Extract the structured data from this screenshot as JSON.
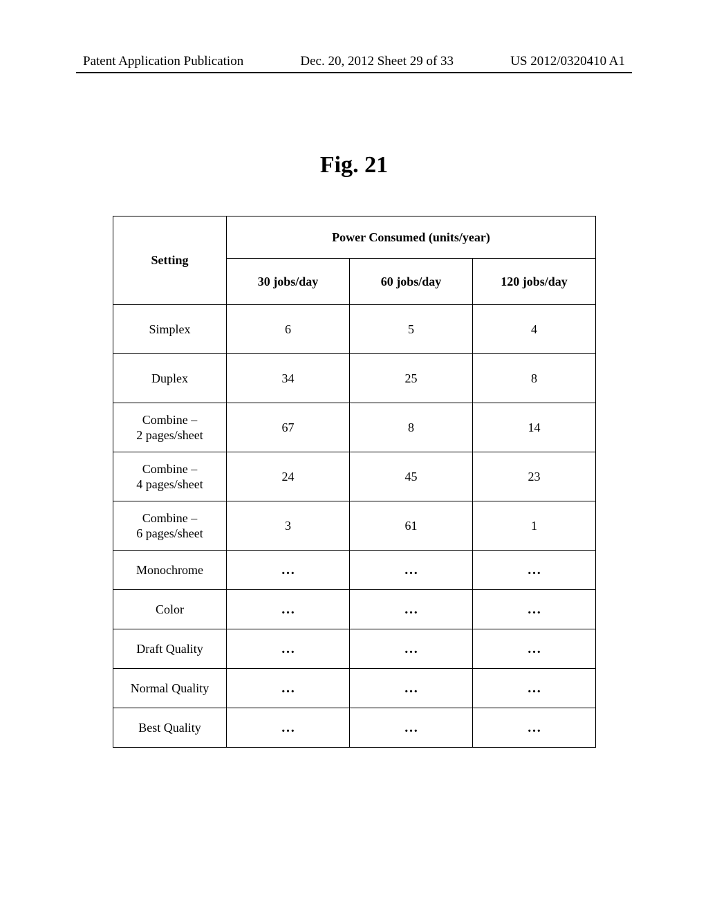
{
  "header": {
    "left": "Patent Application Publication",
    "center": "Dec. 20, 2012  Sheet 29 of 33",
    "right": "US 2012/0320410 A1"
  },
  "figure_title": "Fig. 21",
  "chart_data": {
    "type": "table",
    "title": "Power Consumed  (units/year)",
    "setting_header": "Setting",
    "columns": [
      "30 jobs/day",
      "60 jobs/day",
      "120 jobs/day"
    ],
    "rows": [
      {
        "setting": "Simplex",
        "v": [
          "6",
          "5",
          "4"
        ],
        "small": false
      },
      {
        "setting": "Duplex",
        "v": [
          "34",
          "25",
          "8"
        ],
        "small": false
      },
      {
        "setting": "Combine –\n2 pages/sheet",
        "v": [
          "67",
          "8",
          "14"
        ],
        "small": false,
        "two_line": true
      },
      {
        "setting": "Combine –\n4 pages/sheet",
        "v": [
          "24",
          "45",
          "23"
        ],
        "small": false,
        "two_line": true
      },
      {
        "setting": "Combine –\n6 pages/sheet",
        "v": [
          "3",
          "61",
          "1"
        ],
        "small": false,
        "two_line": true
      },
      {
        "setting": "Monochrome",
        "v": [
          "…",
          "…",
          "…"
        ],
        "small": true,
        "dots": true
      },
      {
        "setting": "Color",
        "v": [
          "…",
          "…",
          "…"
        ],
        "small": true,
        "dots": true
      },
      {
        "setting": "Draft Quality",
        "v": [
          "…",
          "…",
          "…"
        ],
        "small": true,
        "dots": true
      },
      {
        "setting": "Normal Quality",
        "v": [
          "…",
          "…",
          "…"
        ],
        "small": true,
        "dots": true
      },
      {
        "setting": "Best Quality",
        "v": [
          "…",
          "…",
          "…"
        ],
        "small": true,
        "dots": true
      }
    ]
  }
}
